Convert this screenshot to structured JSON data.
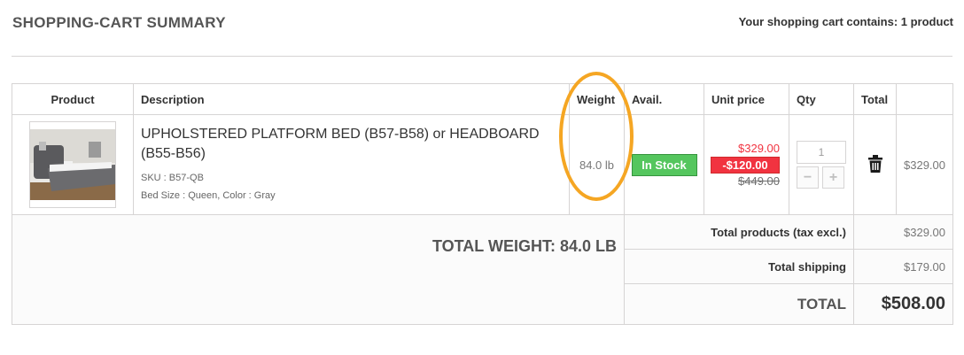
{
  "page": {
    "title": "SHOPPING-CART SUMMARY",
    "cart_count_text": "Your shopping cart contains: 1 product"
  },
  "table": {
    "headers": {
      "product": "Product",
      "description": "Description",
      "weight": "Weight",
      "avail": "Avail.",
      "unit_price": "Unit price",
      "qty": "Qty",
      "total": "Total"
    },
    "items": [
      {
        "name": "UPHOLSTERED PLATFORM BED (B57-B58) or HEADBOARD (B55-B56)",
        "sku": "SKU : B57-QB",
        "attributes": "Bed Size : Queen, Color : Gray",
        "weight": "84.0 lb",
        "availability": "In Stock",
        "price_now": "$329.00",
        "discount": "-$120.00",
        "price_old": "$449.00",
        "qty": "1",
        "minus": "−",
        "plus": "+",
        "line_total": "$329.00"
      }
    ]
  },
  "summary": {
    "total_weight": "TOTAL WEIGHT: 84.0 LB",
    "products_label": "Total products (tax excl.)",
    "products_value": "$329.00",
    "shipping_label": "Total shipping",
    "shipping_value": "$179.00",
    "total_label": "TOTAL",
    "total_value": "$508.00"
  },
  "colors": {
    "accent_ring": "#f5a623",
    "in_stock": "#55c65e",
    "discount": "#f13340"
  }
}
